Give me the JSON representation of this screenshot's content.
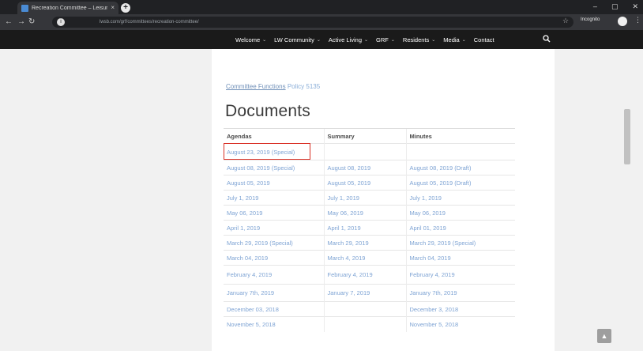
{
  "browser": {
    "tab_title": "Recreation Committee – Leisure",
    "url": "lwsb.com/grf/committees/recreation-committee/",
    "incognito_label": "Incognito"
  },
  "site_nav": {
    "items": [
      {
        "label": "Welcome",
        "has_menu": true
      },
      {
        "label": "LW Community",
        "has_menu": true
      },
      {
        "label": "Active Living",
        "has_menu": true
      },
      {
        "label": "GRF",
        "has_menu": true
      },
      {
        "label": "Residents",
        "has_menu": true
      },
      {
        "label": "Media",
        "has_menu": true
      },
      {
        "label": "Contact",
        "has_menu": false
      }
    ]
  },
  "breadcrumb": {
    "link": "Committee Functions",
    "policy": "Policy 5135"
  },
  "documents": {
    "title": "Documents",
    "columns": [
      "Agendas",
      "Summary",
      "Minutes"
    ],
    "rows": [
      [
        "August 23, 2019 (Special)",
        "",
        ""
      ],
      [
        "August 08, 2019 (Special)",
        "August 08, 2019",
        "August 08, 2019 (Draft)"
      ],
      [
        "August 05, 2019",
        "August 05, 2019",
        "August 05, 2019 (Draft)"
      ],
      [
        "July 1, 2019",
        "July 1, 2019",
        "July 1, 2019"
      ],
      [
        "May 06, 2019",
        "May 06, 2019",
        "May 06, 2019"
      ],
      [
        "April 1, 2019",
        "April 1, 2019",
        "April 01, 2019"
      ],
      [
        "March 29, 2019 (Special)",
        "March 29, 2019",
        "March 29, 2019 (Special)"
      ],
      [
        "March 04, 2019",
        "March 4, 2019",
        "March 04, 2019"
      ],
      [
        "February 4, 2019",
        "February 4, 2019",
        "February 4, 2019"
      ],
      [
        "January 7th, 2019",
        "January 7, 2019",
        "January 7th, 2019"
      ],
      [
        "December 03, 2018",
        "",
        "December 3, 2018"
      ],
      [
        "November 5, 2018",
        "",
        "November 5, 2018"
      ]
    ]
  },
  "colors": {
    "link": "#7fa4d4",
    "highlight": "#d93025",
    "nav_bg": "#1a1a1a"
  }
}
